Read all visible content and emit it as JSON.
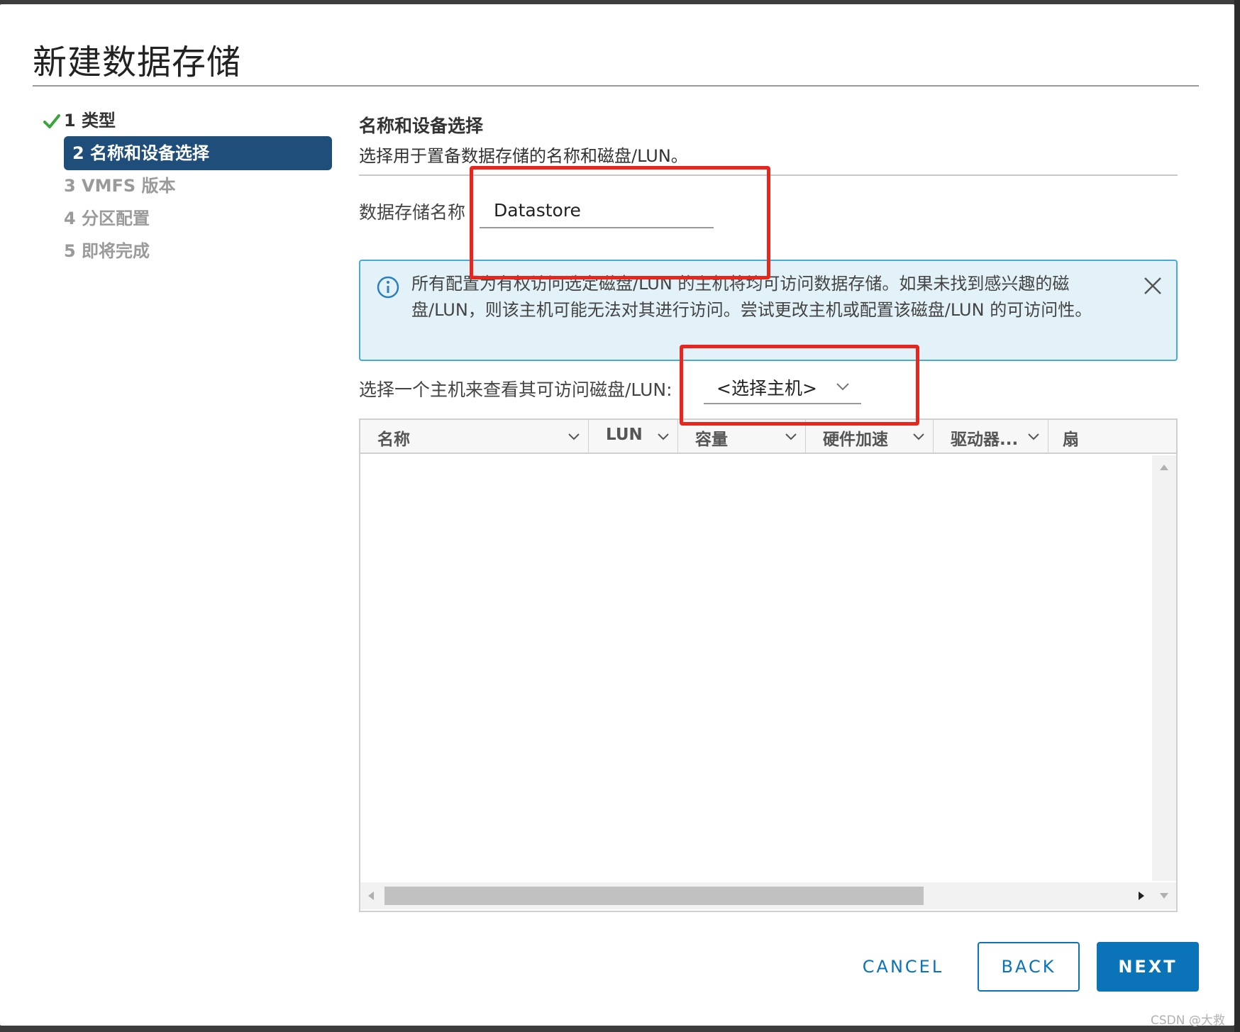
{
  "dialog": {
    "title": "新建数据存储"
  },
  "steps": [
    {
      "label": "1 类型",
      "state": "done"
    },
    {
      "label": "2 名称和设备选择",
      "state": "active"
    },
    {
      "label": "3 VMFS 版本",
      "state": "todo"
    },
    {
      "label": "4 分区配置",
      "state": "todo"
    },
    {
      "label": "5 即将完成",
      "state": "todo"
    }
  ],
  "section": {
    "title": "名称和设备选择",
    "description": "选择用于置备数据存储的名称和磁盘/LUN。"
  },
  "datastore_name": {
    "label": "数据存储名称",
    "value": "Datastore"
  },
  "info": {
    "text": "所有配置为有权访问选定磁盘/LUN 的主机将均可访问数据存储。如果未找到感兴趣的磁盘/LUN，则该主机可能无法对其进行访问。尝试更改主机或配置该磁盘/LUN 的可访问性。"
  },
  "host_select": {
    "label": "选择一个主机来查看其可访问磁盘/LUN:",
    "value": "<选择主机>"
  },
  "table": {
    "columns": [
      "名称",
      "LUN",
      "容量",
      "硬件加速",
      "驱动器...",
      "扇"
    ]
  },
  "buttons": {
    "cancel": "CANCEL",
    "back": "BACK",
    "next": "NEXT"
  },
  "watermark": "CSDN @大救",
  "colors": {
    "primary": "#0b73b8",
    "active_step": "#1f4e7a",
    "annotation": "#e8261e",
    "info_bg": "#e3f2f8"
  }
}
